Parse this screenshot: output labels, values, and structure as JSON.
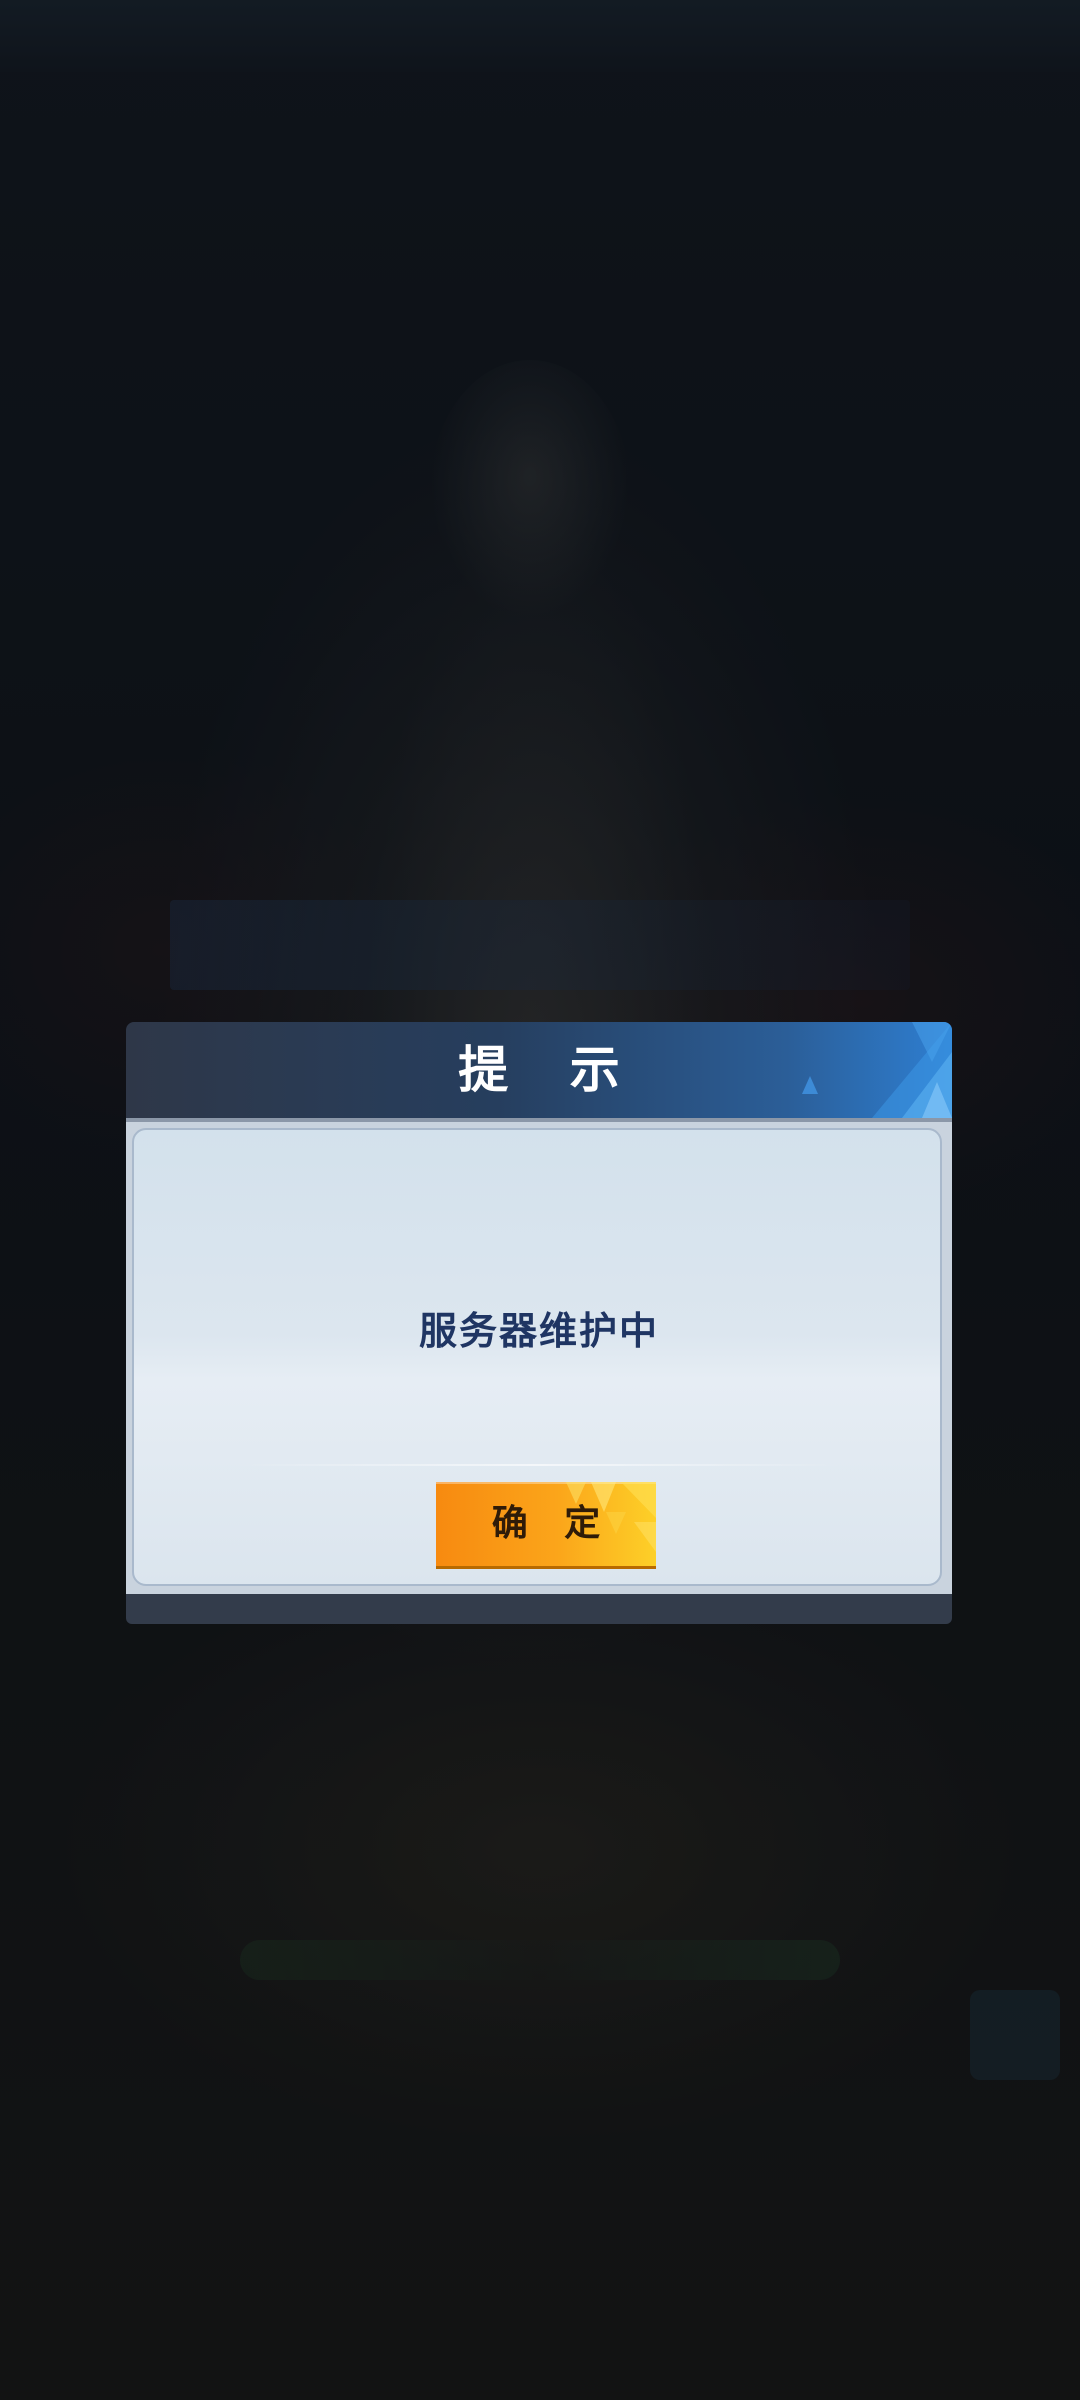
{
  "dialog": {
    "title": "提 示",
    "message": "服务器维护中",
    "confirm_label": "确 定"
  },
  "colors": {
    "header_gradient_start": "#2e3748",
    "header_gradient_end": "#2e7fd2",
    "message_text": "#1f3563",
    "button_orange": "#f78a10",
    "button_yellow": "#fdd028"
  },
  "icons": {
    "header_decoration": "triangle-pattern-icon",
    "button_decoration": "triangle-pattern-icon"
  }
}
